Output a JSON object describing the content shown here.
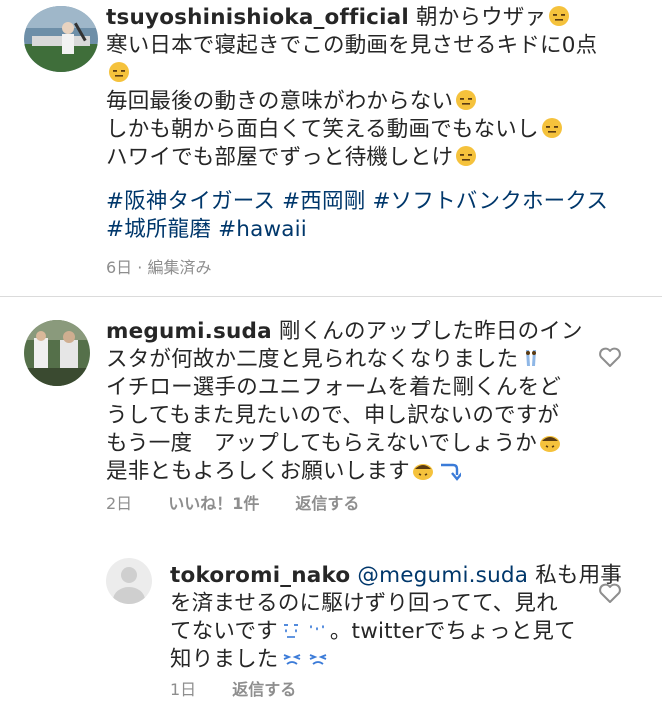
{
  "post_caption": {
    "username": "tsuyoshinishioka_official",
    "lines": [
      "朝からウザァ",
      "寒い日本で寝起きでこの動画を見させるキドに0点",
      "毎回最後の動きの意味がわからない",
      "しかも朝から面白くて笑える動画でもないし",
      "ハワイでも部屋でずっと待機しとけ"
    ],
    "hashtags": [
      "#阪神タイガース",
      "#西岡剛",
      "#ソフトバンクホークス",
      "#城所龍磨",
      "#hawaii"
    ],
    "time": "6日",
    "edited": "編集済み",
    "separator": " · "
  },
  "comments": [
    {
      "username": "megumi.suda",
      "lines": [
        "剛くんのアップした昨日のイン",
        "スタが何故か二度と見られなくなりました",
        "イチロー選手のユニフォームを着た剛くんをど",
        "うしてもまた見たいので、申し訳ないのですが",
        "もう一度　アップしてもらえないでしょうか",
        "是非ともよろしくお願いします"
      ],
      "time": "2日",
      "likes": "いいね！1件",
      "reply": "返信する"
    }
  ],
  "replies": [
    {
      "username": "tokoromi_nako",
      "mention": "@megumi.suda",
      "lines": [
        "私も用事",
        "を済ませるのに駆けずり回ってて、見れ",
        "てないです",
        "。twitterでちょっと見て",
        "知りました"
      ],
      "time": "1日",
      "reply": "返信する"
    }
  ],
  "colors": {
    "hashtag": "#00376b",
    "meta": "#8e8e8e",
    "emoji_face": "#f5c23c"
  }
}
